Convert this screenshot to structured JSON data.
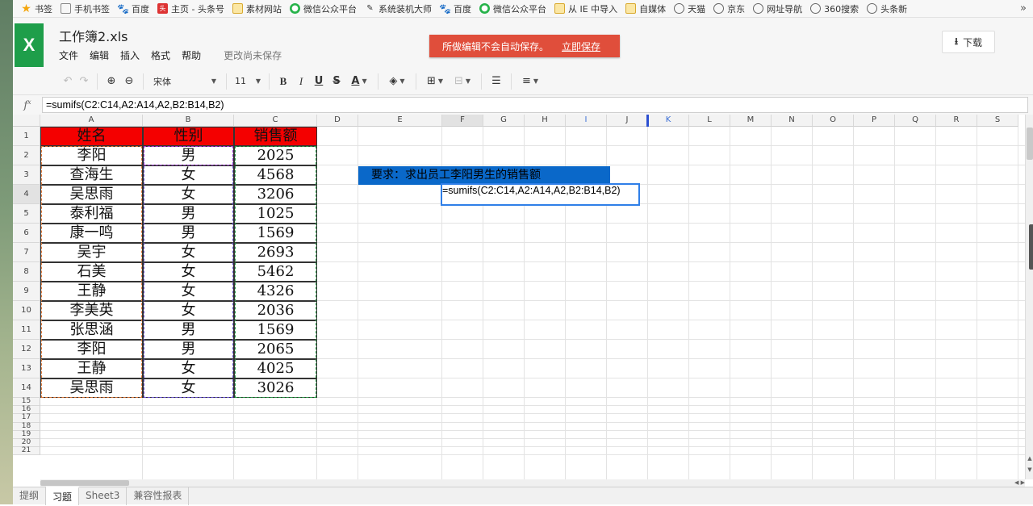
{
  "bookmarks": {
    "items": [
      {
        "label": "书签",
        "icon": "star-icon"
      },
      {
        "label": "手机书签",
        "icon": "mobile-icon"
      },
      {
        "label": "百度",
        "icon": "paw-icon"
      },
      {
        "label": "主页 - 头条号",
        "icon": "toutiao-icon"
      },
      {
        "label": "素材网站",
        "icon": "folder-icon"
      },
      {
        "label": "微信公众平台",
        "icon": "wechat-icon"
      },
      {
        "label": "系统装机大师",
        "icon": "tool-icon"
      },
      {
        "label": "百度",
        "icon": "paw-icon"
      },
      {
        "label": "微信公众平台",
        "icon": "wechat-icon"
      },
      {
        "label": "从 IE 中导入",
        "icon": "folder-icon"
      },
      {
        "label": "自媒体",
        "icon": "folder-icon"
      },
      {
        "label": "天猫",
        "icon": "globe-icon"
      },
      {
        "label": "京东",
        "icon": "globe-icon"
      },
      {
        "label": "网址导航",
        "icon": "globe-icon"
      },
      {
        "label": "360搜索",
        "icon": "globe-icon"
      },
      {
        "label": "头条新",
        "icon": "globe-icon"
      }
    ],
    "more": "»"
  },
  "app": {
    "logo": "X",
    "title": "工作簿2.xls",
    "menu": [
      "文件",
      "编辑",
      "插入",
      "格式",
      "帮助"
    ],
    "unsaved": "更改尚未保存",
    "alert": "所做编辑不会自动保存。",
    "save_now": "立即保存",
    "download": "下载",
    "colors": {
      "accent": "#1e9e4a",
      "alert": "#e04e3b"
    }
  },
  "toolbar": {
    "font": "宋体",
    "size": "11",
    "bold": "B",
    "italic": "I",
    "underline": "U",
    "strike": "S",
    "font_color": "A"
  },
  "formula_bar": {
    "fx": "f",
    "fx_sup": "x",
    "value": "=sumifs(C2:C14,A2:A14,A2,B2:B14,B2)"
  },
  "sheet": {
    "columns": [
      "A",
      "B",
      "C",
      "D",
      "E",
      "F",
      "G",
      "H",
      "I",
      "J",
      "K",
      "L",
      "M",
      "N",
      "O",
      "P",
      "Q",
      "R",
      "S"
    ],
    "rows": [
      "1",
      "2",
      "3",
      "4",
      "5",
      "6",
      "7",
      "8",
      "9",
      "10",
      "11",
      "12",
      "13",
      "14",
      "15",
      "16",
      "17",
      "18",
      "19",
      "20",
      "21"
    ],
    "header": [
      "姓名",
      "性别",
      "销售额"
    ],
    "data": [
      [
        "李阳",
        "男",
        "2025"
      ],
      [
        "查海生",
        "女",
        "4568"
      ],
      [
        "吴思雨",
        "女",
        "3206"
      ],
      [
        "泰利福",
        "男",
        "1025"
      ],
      [
        "康一鸣",
        "男",
        "1569"
      ],
      [
        "吴宇",
        "女",
        "2693"
      ],
      [
        "石美",
        "女",
        "5462"
      ],
      [
        "王静",
        "女",
        "4326"
      ],
      [
        "李美英",
        "女",
        "2036"
      ],
      [
        "张思涵",
        "男",
        "1569"
      ],
      [
        "李阳",
        "男",
        "2065"
      ],
      [
        "王静",
        "女",
        "4025"
      ],
      [
        "吴思雨",
        "女",
        "3026"
      ]
    ],
    "note": "要求：求出员工李阳男生的销售额",
    "editing_cell": "=sumifs(C2:C14,A2:A14,A2,B2:B14,B2)",
    "header_color": "#f40000",
    "note_color": "#0a68c9"
  },
  "sheet_tabs": [
    "提纲",
    "习题",
    "Sheet3",
    "兼容性报表"
  ]
}
